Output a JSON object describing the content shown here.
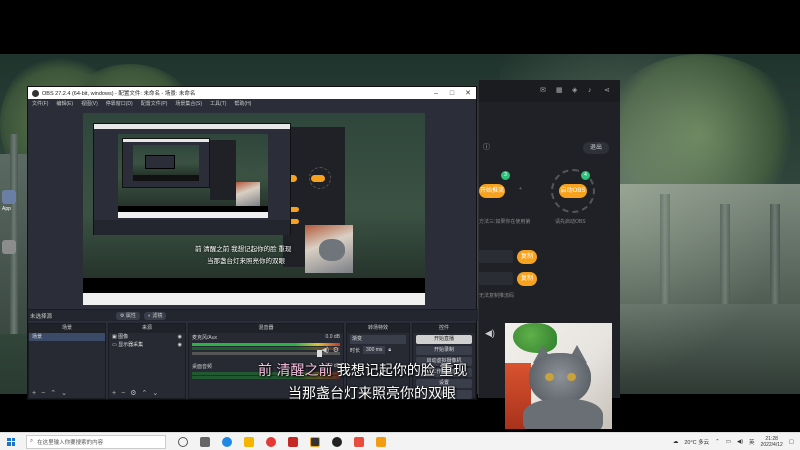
{
  "obs": {
    "title": "OBS 27.2.4 (64-bit, windows) - 配置文件: 未命名 - 场景: 未命名",
    "menu": [
      "文件(F)",
      "编辑(E)",
      "视图(V)",
      "停靠窗口(D)",
      "配置文件(P)",
      "场景集合(S)",
      "工具(T)",
      "帮助(H)"
    ],
    "window_buttons": {
      "minimize": "–",
      "maximize": "□",
      "close": "✕"
    },
    "toolbar": {
      "status_label": "未选择源",
      "properties": "属性",
      "filters": "滤镜"
    },
    "docks": {
      "scenes": {
        "header": "场景",
        "items": [
          "场景"
        ]
      },
      "sources": {
        "header": "来源",
        "items": [
          "图像",
          "显示器采集"
        ]
      },
      "mixer": {
        "header": "混音器",
        "channels": [
          {
            "name": "桌面音频",
            "level": "0.0 dB"
          },
          {
            "name": "麦克风/Aux",
            "level": "0.0 dB"
          }
        ]
      },
      "transitions": {
        "header": "转场特效",
        "type": "渐变",
        "duration_label": "时长",
        "duration": "300 ms"
      },
      "controls": {
        "header": "控件",
        "buttons": [
          "开始直播",
          "开始录制",
          "启动虚拟摄像机",
          "工作室模式",
          "设置",
          "退出"
        ]
      }
    },
    "dock_footer_glyphs": [
      "+",
      "−",
      "⌃",
      "⌄"
    ]
  },
  "live_app": {
    "exit_button": "退出",
    "step_button": "开始推流",
    "step3_number": "3",
    "step4_number": "4",
    "step4_label": "启动OBS",
    "hint1": "方法三:如果你在使用第",
    "hint2": "请先启动OBS",
    "copy_button1": "复制",
    "copy_button2": "复制",
    "footer_hint": "无法复制推流码"
  },
  "lyrics": {
    "line1_done": "前 清醒之前",
    "line1_rest": " 我想记起你的脸 重现",
    "line2": "当那盏台灯来照亮你的双眼"
  },
  "nested_lyrics": {
    "line1": "前 清醒之前 我想记起你的脸 重现",
    "line2": "当那盏台灯来照亮你的双眼"
  },
  "taskbar": {
    "search_placeholder": "在这里输入你要搜索的内容",
    "weather": "20°C 多云",
    "time": "21:28",
    "date": "2022/4/12",
    "lang": "英"
  },
  "desktop": {
    "left_icon_label": "App"
  },
  "colors": {
    "accent_orange": "#f6a21e",
    "obs_bg": "#2b2e38",
    "meter_green": "#2db24a",
    "taskbar": "#f3f3f3"
  }
}
